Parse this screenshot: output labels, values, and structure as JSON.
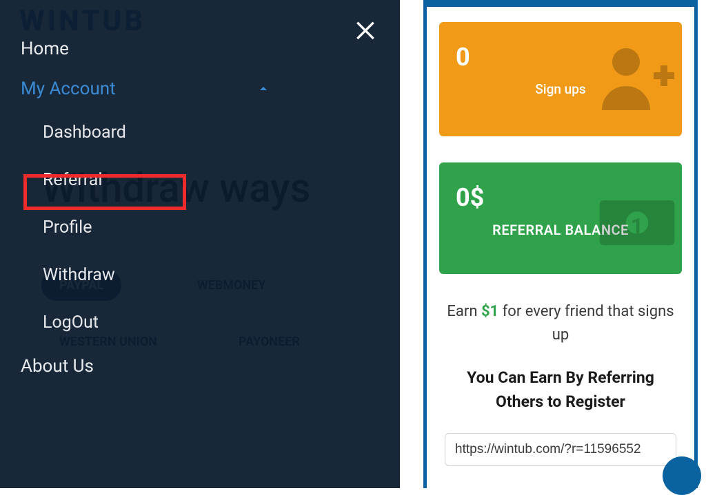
{
  "bg": {
    "logo": "WINTUB",
    "heading": "Withdraw ways",
    "chips": [
      "PAYPAL",
      "WEBMONEY",
      "WESTERN UNION",
      "PAYONEER"
    ]
  },
  "nav": {
    "home": "Home",
    "myAccount": "My Account",
    "sub": {
      "dashboard": "Dashboard",
      "referral": "Referral",
      "profile": "Profile",
      "withdraw": "Withdraw",
      "logout": "LogOut"
    },
    "aboutUs": "About Us"
  },
  "cards": {
    "signups": {
      "value": "0",
      "label": "Sign ups"
    },
    "balance": {
      "value": "0$",
      "label": "REFERRAL BALANCE"
    }
  },
  "earn": {
    "prefix": "Earn ",
    "amount": "$1",
    "suffix": " for every friend that signs up"
  },
  "subheading": "You Can Earn By Referring Others to Register",
  "refUrl": "https://wintub.com/?r=11596552"
}
